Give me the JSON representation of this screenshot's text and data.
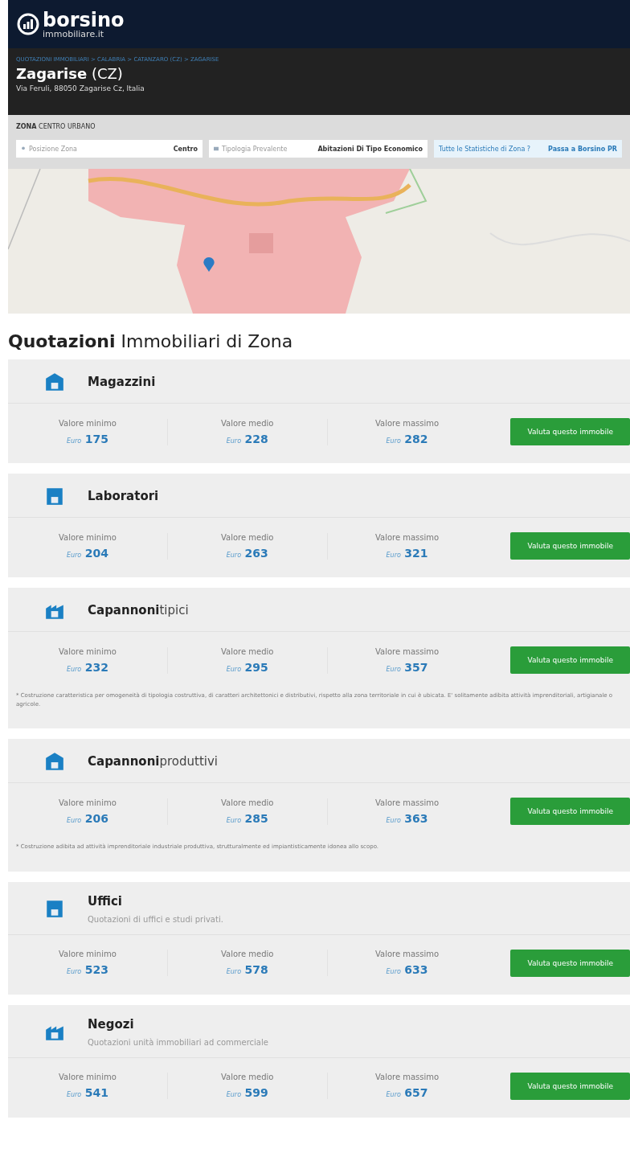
{
  "header": {
    "logo_main": "borsino",
    "logo_sub": "immobiliare.it"
  },
  "location": {
    "breadcrumb": "QUOTAZIONI IMMOBILIARI > CALABRIA > CATANZARO (CZ) > ZAGARISE",
    "city": "Zagarise",
    "province": "(CZ)",
    "address": "Via Feruli, 88050 Zagarise Cz, Italia"
  },
  "zone": {
    "label": "ZONA",
    "name": "CENTRO URBANO",
    "filters": [
      {
        "placeholder": "Posizione Zona",
        "value": "Centro"
      },
      {
        "placeholder": "Tipologia Prevalente",
        "value": "Abitazioni Di Tipo Economico"
      }
    ],
    "stats_link": "Tutte le Statistiche di Zona ?",
    "pro_link": "Passa a Borsino PR"
  },
  "title": {
    "bold": "Quotazioni",
    "rest": "Immobiliari di Zona"
  },
  "categories": [
    {
      "name": "Magazzini",
      "values": [
        {
          "label": "Valore minimo",
          "currency": "Euro",
          "amount": "175"
        },
        {
          "label": "Valore medio",
          "currency": "Euro",
          "amount": "228"
        },
        {
          "label": "Valore massimo",
          "currency": "Euro",
          "amount": "282"
        }
      ],
      "button": "Valuta questo immobile"
    },
    {
      "name": "Laboratori",
      "values": [
        {
          "label": "Valore minimo",
          "currency": "Euro",
          "amount": "204"
        },
        {
          "label": "Valore medio",
          "currency": "Euro",
          "amount": "263"
        },
        {
          "label": "Valore massimo",
          "currency": "Euro",
          "amount": "321"
        }
      ],
      "button": "Valuta questo immobile"
    },
    {
      "name": "Capannoni",
      "name_suffix": "tipici",
      "values": [
        {
          "label": "Valore minimo",
          "currency": "Euro",
          "amount": "232"
        },
        {
          "label": "Valore medio",
          "currency": "Euro",
          "amount": "295"
        },
        {
          "label": "Valore massimo",
          "currency": "Euro",
          "amount": "357"
        }
      ],
      "button": "Valuta questo immobile",
      "note": "* Costruzione caratteristica per omogeneità di tipologia costruttiva, di caratteri architettonici e distributivi, rispetto alla zona territoriale in cui è ubicata. E' solitamente adibita attività imprenditoriali, artigianale o agricole."
    },
    {
      "name": "Capannoni",
      "name_suffix": "produttivi",
      "values": [
        {
          "label": "Valore minimo",
          "currency": "Euro",
          "amount": "206"
        },
        {
          "label": "Valore medio",
          "currency": "Euro",
          "amount": "285"
        },
        {
          "label": "Valore massimo",
          "currency": "Euro",
          "amount": "363"
        }
      ],
      "button": "Valuta questo immobile",
      "note": "* Costruzione adibita ad attività imprenditoriale industriale produttiva, strutturalmente ed impiantisticamente idonea allo scopo."
    },
    {
      "name": "Uffici",
      "subtitle": "Quotazioni di uffici e studi privati.",
      "values": [
        {
          "label": "Valore minimo",
          "currency": "Euro",
          "amount": "523"
        },
        {
          "label": "Valore medio",
          "currency": "Euro",
          "amount": "578"
        },
        {
          "label": "Valore massimo",
          "currency": "Euro",
          "amount": "633"
        }
      ],
      "button": "Valuta questo immobile"
    },
    {
      "name": "Negozi",
      "subtitle": "Quotazioni unità immobiliari ad commerciale",
      "values": [
        {
          "label": "Valore minimo",
          "currency": "Euro",
          "amount": "541"
        },
        {
          "label": "Valore medio",
          "currency": "Euro",
          "amount": "599"
        },
        {
          "label": "Valore massimo",
          "currency": "Euro",
          "amount": "657"
        }
      ],
      "button": "Valuta questo immobile"
    }
  ]
}
